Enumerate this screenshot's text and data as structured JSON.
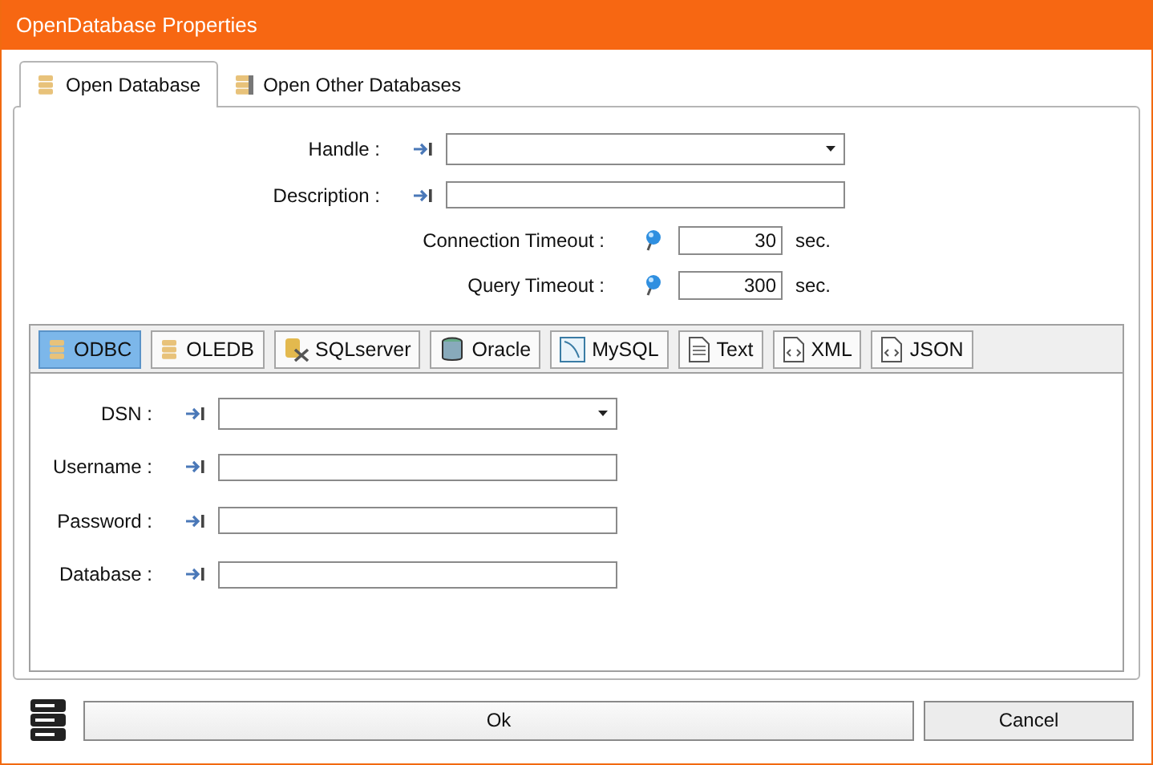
{
  "window": {
    "title": "OpenDatabase Properties"
  },
  "tabs": [
    {
      "label": "Open Database",
      "selected": true
    },
    {
      "label": "Open Other Databases",
      "selected": false
    }
  ],
  "fields": [
    {
      "label": "Handle :",
      "kind": "dropdown"
    },
    {
      "label": "Description :",
      "kind": "text"
    }
  ],
  "timeouts": [
    {
      "label": "Connection Timeout :",
      "value": "30",
      "unit": "sec."
    },
    {
      "label": "Query Timeout :",
      "value": "300",
      "unit": "sec."
    }
  ],
  "sources": [
    {
      "label": "ODBC",
      "selected": true
    },
    {
      "label": "OLEDB",
      "selected": false
    },
    {
      "label": "SQLserver",
      "selected": false
    },
    {
      "label": "Oracle",
      "selected": false
    },
    {
      "label": "MySQL",
      "selected": false
    },
    {
      "label": "Text",
      "selected": false
    },
    {
      "label": "XML",
      "selected": false
    },
    {
      "label": "JSON",
      "selected": false
    }
  ],
  "source_fields": [
    {
      "label": "DSN :",
      "kind": "dropdown"
    },
    {
      "label": "Username :",
      "kind": "text"
    },
    {
      "label": "Password :",
      "kind": "text"
    },
    {
      "label": "Database :",
      "kind": "text"
    }
  ],
  "buttons": [
    {
      "label": "Ok"
    },
    {
      "label": "Cancel"
    }
  ]
}
